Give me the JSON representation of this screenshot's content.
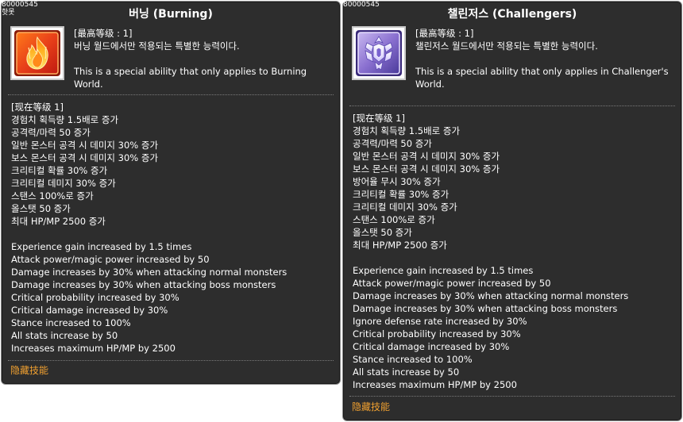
{
  "tooltips": [
    {
      "id_text": "80000545",
      "id_sub": "핫못",
      "title": "버닝 (Burning)",
      "level_max": "[最高等级 : 1]",
      "desc_ko": "버닝 월드에서만 적용되는 특별한 능력이다.",
      "desc_en": "This is a special ability that only applies to Burning World.",
      "current_level": "[现在等级 1]",
      "effects_ko": [
        "경험치 획득량 1.5배로 증가",
        "공격력/마력 50 증가",
        "일반 몬스터 공격 시 데미지 30% 증가",
        "보스 몬스터 공격 시 데미지 30% 증가",
        "크리티컬 확률 30% 증가",
        "크리티컬 데미지 30% 증가",
        "스탠스 100%로 증가",
        "올스탯 50 증가",
        "최대 HP/MP 2500 증가"
      ],
      "effects_en": [
        "Experience gain increased by 1.5 times",
        "Attack power/magic power increased by 50",
        "Damage increases by 30% when attacking normal monsters",
        "Damage increases by 30% when attacking boss monsters",
        "Critical probability increased by 30%",
        "Critical damage increased by 30%",
        "Stance increased to 100%",
        "All stats increase by 50",
        "Increases maximum HP/MP by 2500"
      ],
      "hidden_label": "隐藏技能",
      "icon": "burning-flame-icon"
    },
    {
      "id_text": "80000545",
      "id_sub": "",
      "title": "챌린저스 (Challengers)",
      "level_max": "[最高等级 : 1]",
      "desc_ko": "챌린저스 월드에서만 적용되는 특별한 능력이다.",
      "desc_en": "This is a special ability that only applies in Challenger's World.",
      "current_level": "[现在等级 1]",
      "effects_ko": [
        "경험치 획득량 1.5배로 증가",
        "공격력/마력 50 증가",
        "일반 몬스터 공격 시 데미지 30% 증가",
        "보스 몬스터 공격 시 데미지 30% 증가",
        "방어율 무시 30% 증가",
        "크리티컬 확률 30% 증가",
        "크리티컬 데미지 30% 증가",
        "스탠스 100%로 증가",
        "올스탯 50 증가",
        "최대 HP/MP 2500 증가"
      ],
      "effects_en": [
        "Experience gain increased by 1.5 times",
        "Attack power/magic power increased by 50",
        "Damage increases by 30% when attacking normal monsters",
        "Damage increases by 30% when attacking boss monsters",
        "Ignore defense rate increased by 30%",
        "Critical probability increased by 30%",
        "Critical damage increased by 30%",
        "Stance increased to 100%",
        "All stats increase by 50",
        "Increases maximum HP/MP by 2500"
      ],
      "hidden_label": "隐藏技能",
      "icon": "challengers-crest-icon"
    }
  ],
  "colors": {
    "panel_bg": "#2d2d2d",
    "hidden_label": "#f0a030",
    "text": "#ffffff"
  }
}
